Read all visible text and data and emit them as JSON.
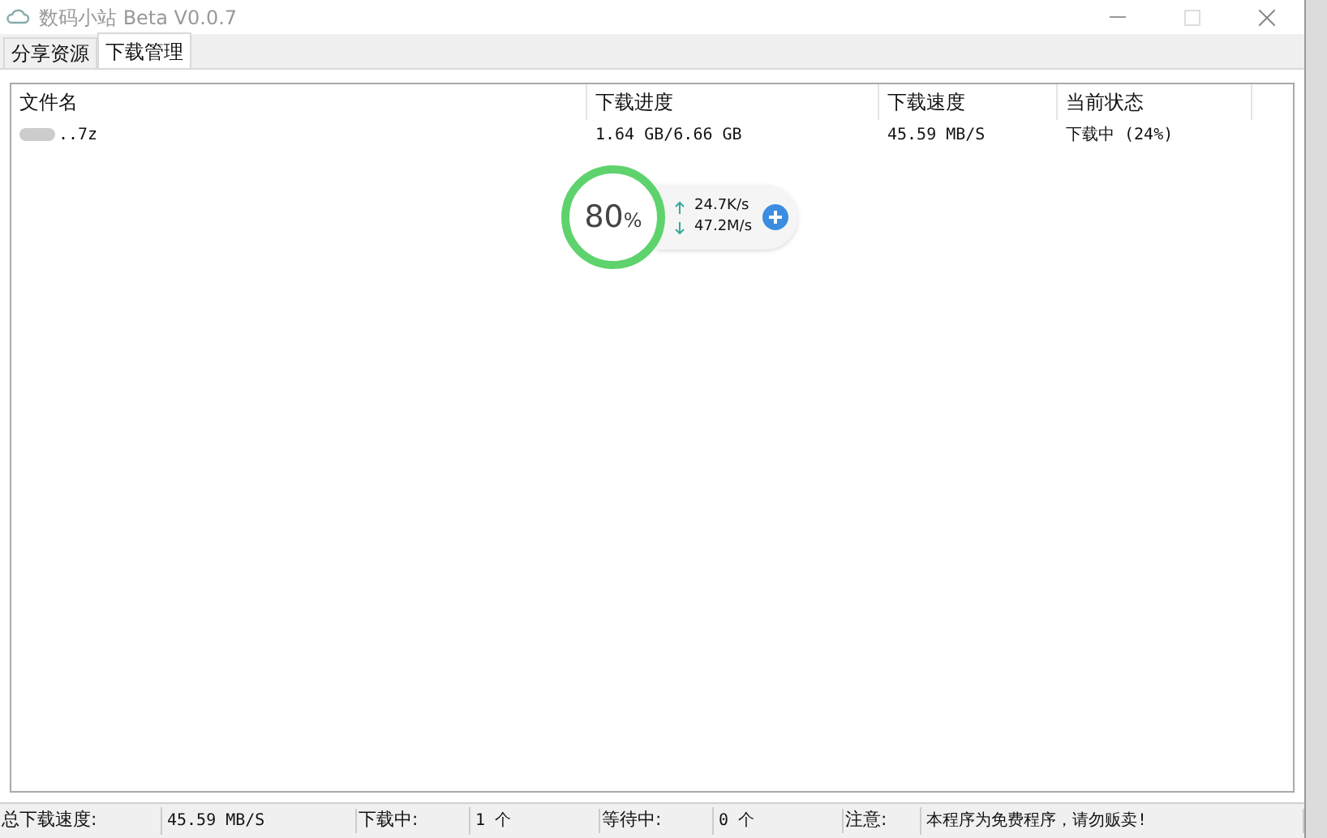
{
  "window": {
    "title": "数码小站 Beta V0.0.7"
  },
  "tabs": [
    {
      "label": "分享资源",
      "selected": false
    },
    {
      "label": "下载管理",
      "selected": true
    }
  ],
  "table": {
    "columns": [
      "文件名",
      "下载进度",
      "下载速度",
      "当前状态"
    ],
    "rows": [
      {
        "cells": [
          "..7z",
          "1.64 GB/6.66 GB",
          "45.59 MB/S",
          "下载中 (24%)"
        ],
        "selected": false
      }
    ]
  },
  "speed_widget": {
    "percent": "80",
    "unit": "%",
    "upload": "24.7K/s",
    "download": "47.2M/s"
  },
  "status_bar": [
    {
      "label": "总下载速度:",
      "value": "45.59 MB/S"
    },
    {
      "label": "下载中:",
      "value": "1 个"
    },
    {
      "label": "等待中:",
      "value": "0 个"
    },
    {
      "label": "注意:",
      "value": "本程序为免费程序，请勿贩卖!"
    }
  ]
}
